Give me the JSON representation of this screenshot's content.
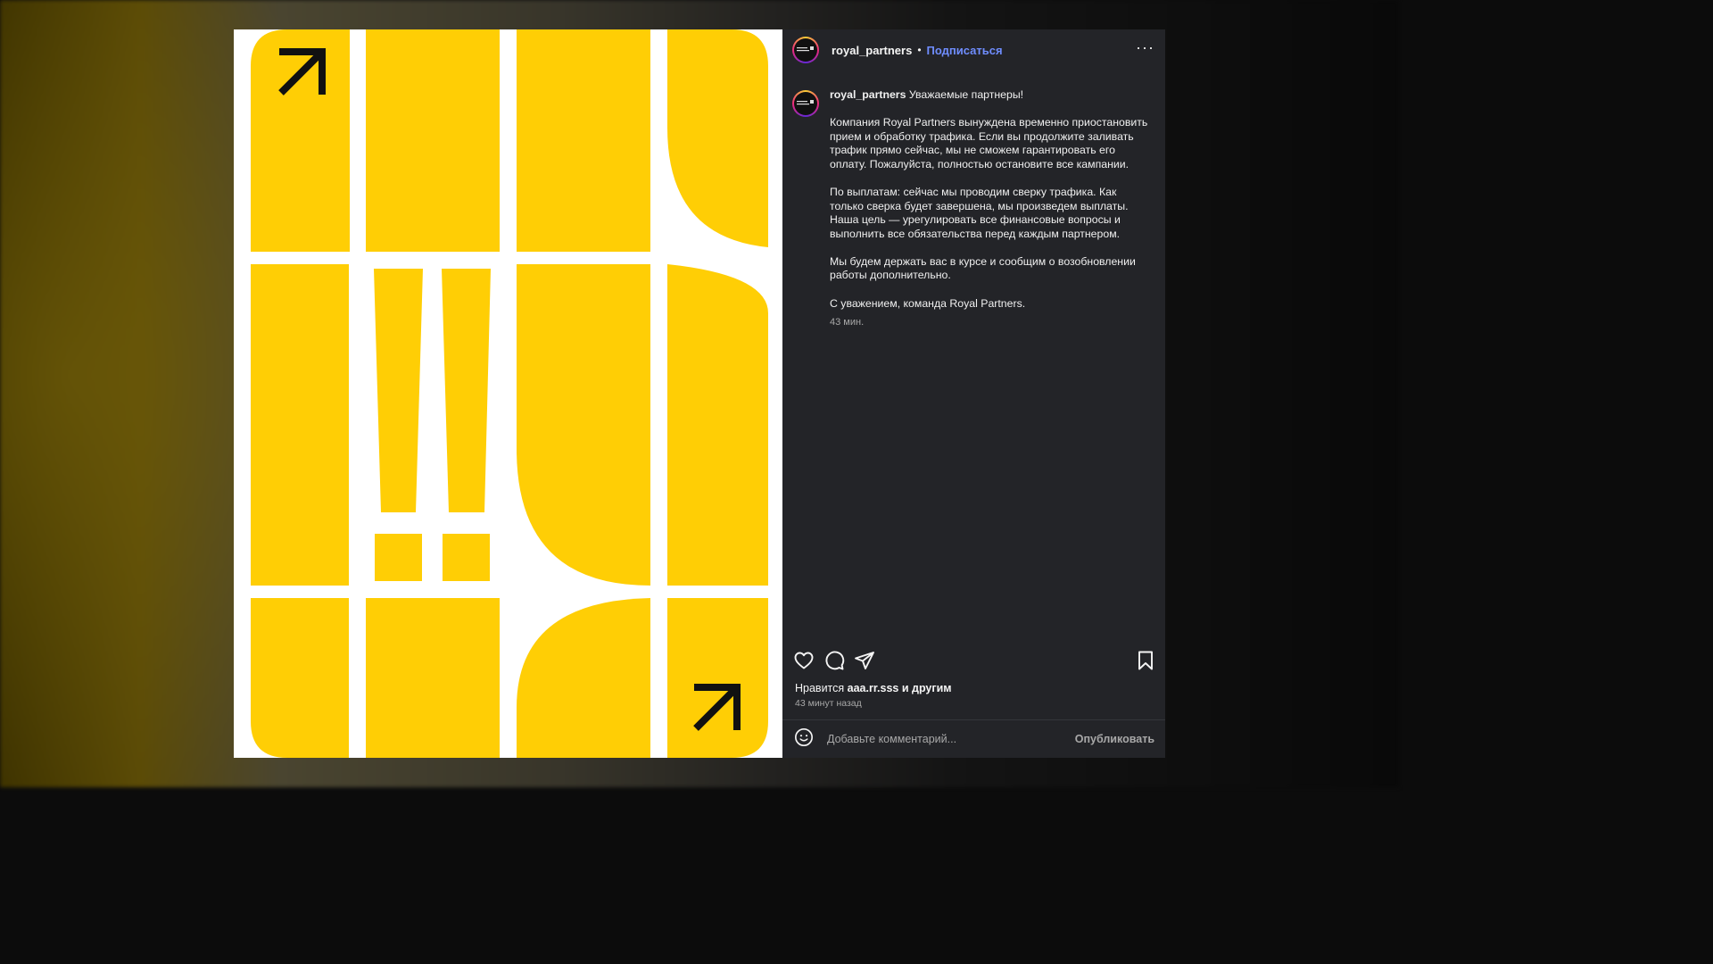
{
  "post": {
    "author": "royal_partners",
    "separator": "•",
    "follow_label": "Подписаться",
    "more_label": "···",
    "avatar_text": "ROYAL PARTNERS",
    "caption": {
      "username": "royal_partners",
      "greeting": "Уважаемые партнеры!",
      "paragraphs": [
        "Компания Royal Partners вынуждена временно приостановить прием и обработку трафика. Если вы продолжите заливать трафик прямо сейчас, мы не сможем гарантировать его оплату. Пожалуйста, полностью остановите все кампании.",
        "По выплатам: сейчас мы проводим сверку трафика. Как только сверка будет завершена, мы произведем выплаты. Наша цель — урегулировать все финансовые вопросы и выполнить все обязательства перед каждым партнером.",
        "Мы будем держать вас в курсе и сообщим о возобновлении работы дополнительно.",
        "С уважением, команда Royal Partners."
      ],
      "time": "43 мин."
    },
    "likes": {
      "prefix": "Нравится",
      "user": "aaa.rr.sss",
      "middle": "и",
      "others": "другим"
    },
    "time_ago": "43 минут назад",
    "comment": {
      "placeholder": "Добавьте комментарий...",
      "publish_label": "Опубликовать"
    },
    "icons": {
      "like": "heart-icon",
      "comment": "comment-icon",
      "share": "share-icon",
      "save": "bookmark-icon",
      "emoji": "emoji-icon"
    },
    "colors": {
      "accent_yellow": "#ffce05",
      "follow_blue": "#6f8dff",
      "panel_bg": "#232428"
    }
  }
}
